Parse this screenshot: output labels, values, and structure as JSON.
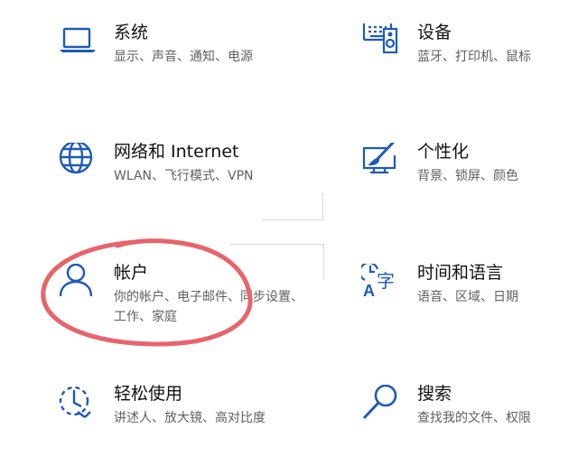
{
  "settings": {
    "tiles": [
      {
        "icon": "laptop-icon",
        "title": "系统",
        "desc": "显示、声音、通知、电源"
      },
      {
        "icon": "keyboard-speaker-icon",
        "title": "设备",
        "desc": "蓝牙、打印机、鼠标"
      },
      {
        "icon": "globe-icon",
        "title": "网络和 Internet",
        "desc": "WLAN、飞行模式、VPN"
      },
      {
        "icon": "paint-monitor-icon",
        "title": "个性化",
        "desc": "背景、锁屏、颜色"
      },
      {
        "icon": "person-icon",
        "title": "帐户",
        "desc": "你的帐户、电子邮件、同步设置、工作、家庭"
      },
      {
        "icon": "time-language-icon",
        "title": "时间和语言",
        "desc": "语音、区域、日期"
      },
      {
        "icon": "ease-of-access-icon",
        "title": "轻松使用",
        "desc": "讲述人、放大镜、高对比度"
      },
      {
        "icon": "search-icon",
        "title": "搜索",
        "desc": "查找我的文件、权限"
      }
    ]
  },
  "colors": {
    "icon_blue": "#1f5ab8",
    "annotation_red": "#e8636b",
    "title_text": "#111111",
    "desc_text": "#5f5f5f"
  }
}
